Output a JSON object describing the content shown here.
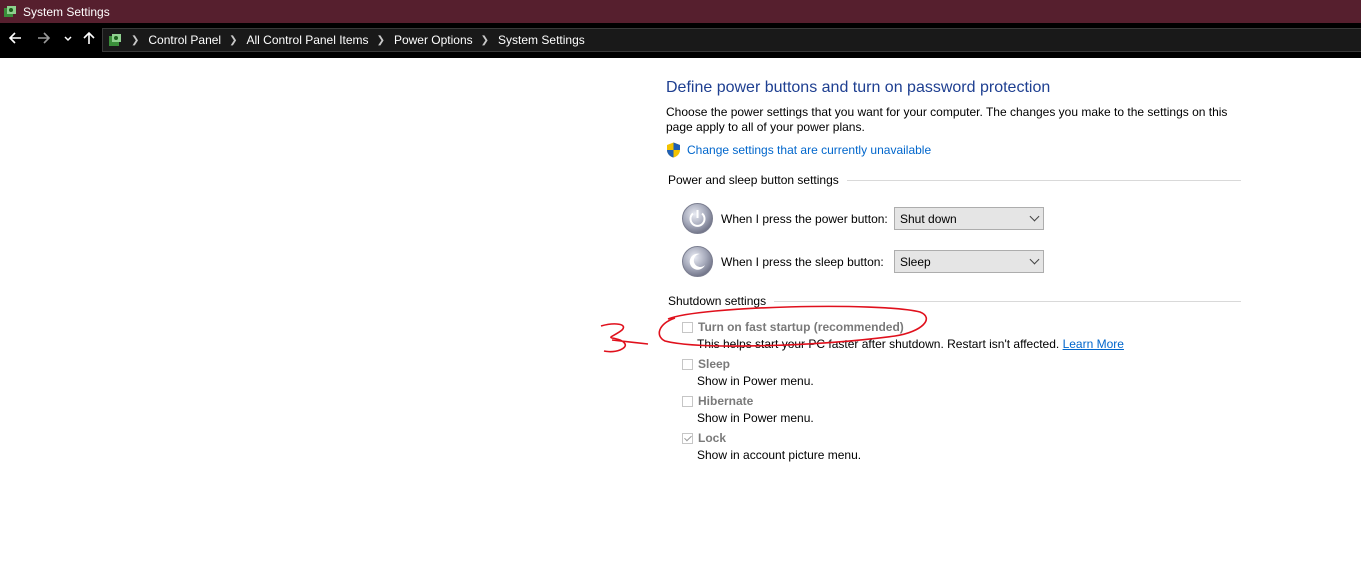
{
  "window": {
    "title": "System Settings"
  },
  "breadcrumb": [
    "Control Panel",
    "All Control Panel Items",
    "Power Options",
    "System Settings"
  ],
  "page": {
    "title": "Define power buttons and turn on password protection",
    "description": "Choose the power settings that you want for your computer. The changes you make to the settings on this page apply to all of your power plans.",
    "admin_link": "Change settings that are currently unavailable"
  },
  "power_section": {
    "heading": "Power and sleep button settings",
    "power_button_label": "When I press the power button:",
    "power_button_value": "Shut down",
    "sleep_button_label": "When I press the sleep button:",
    "sleep_button_value": "Sleep"
  },
  "shutdown_section": {
    "heading": "Shutdown settings",
    "options": [
      {
        "label": "Turn on fast startup (recommended)",
        "desc": "This helps start your PC faster after shutdown. Restart isn't affected.",
        "link": "Learn More",
        "checked": false
      },
      {
        "label": "Sleep",
        "desc": "Show in Power menu.",
        "checked": false
      },
      {
        "label": "Hibernate",
        "desc": "Show in Power menu.",
        "checked": false
      },
      {
        "label": "Lock",
        "desc": "Show in account picture menu.",
        "checked": true
      }
    ]
  },
  "colors": {
    "titlebar": "#561f2e",
    "link": "#0066cc",
    "heading": "#1e3f91",
    "annotation": "#e0101c"
  }
}
